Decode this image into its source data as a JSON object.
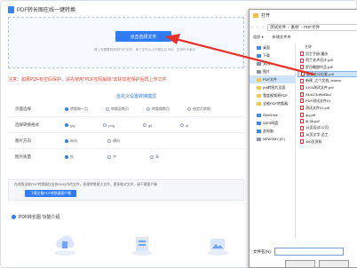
{
  "header": {
    "title": "PDF转长图在线一键转换"
  },
  "upload": {
    "button_label": "点击选择文件",
    "hint": "请上传需要转换的PDF文件，单个文件大小不超过(2.0M)，支持PDF格式"
  },
  "notice": "注意：如果PDF有密码保护，请先使用\"PDF密码解除\"去除加密保护后再上传文件",
  "settings": {
    "title": "自定义设置转换模式",
    "rows": [
      {
        "label": "页面选择",
        "options": [
          "转换每一页",
          "转换奇数页",
          "转换偶数页",
          "指定页转换"
        ],
        "selected": 0
      },
      {
        "label": "选择转换格式",
        "options": [
          "jpg",
          "png",
          "gif",
          "tif"
        ],
        "selected": 0
      },
      {
        "label": "图片方向",
        "options": [
          "纵向",
          "横向"
        ],
        "selected": 0
      },
      {
        "label": "图片质量",
        "options": [
          "低",
          "中",
          "高"
        ],
        "selected": 0
      }
    ]
  },
  "bottom_note": {
    "text": "在线版全能PDF转换器仅支持2M以内的文件，如需转换更大文件，更多格式文件，请下载客户端",
    "button_label": "下载全能PDF转换器客户端"
  },
  "features_title": "PDF转长图 功能介绍",
  "dialog": {
    "title": "打开",
    "path": [
      "测试文件",
      "素材",
      "PDF文件"
    ],
    "toolbar": [
      "组织 ▾",
      "新建文件夹"
    ],
    "nav_items": [
      {
        "label": "桌面",
        "color": "blue",
        "selected": false
      },
      {
        "label": "下载",
        "color": "blue",
        "selected": false
      },
      {
        "label": "文档",
        "color": "gray",
        "selected": false
      },
      {
        "label": "图片",
        "color": "gray",
        "selected": false
      },
      {
        "label": "PDF文件",
        "color": "yellow",
        "selected": true
      },
      {
        "label": "pdf转图片页面",
        "color": "yellow",
        "selected": false
      },
      {
        "label": "零度视频原PDF",
        "color": "yellow",
        "selected": false
      },
      {
        "label": "全能PDF转换器",
        "color": "yellow",
        "selected": false
      },
      {
        "label": "OneDrive",
        "color": "blue",
        "selected": false
      },
      {
        "label": "WPS网盘",
        "color": "blue",
        "selected": false
      },
      {
        "label": "此电脑",
        "color": "blue",
        "selected": false
      },
      {
        "label": "NEWSMY (E:)",
        "color": "gray",
        "selected": false
      }
    ],
    "column_header": "名称",
    "files": [
      {
        "name": "员工手册-重庆",
        "selected": false
      },
      {
        "name": "荷兰艺术设计.pdf",
        "selected": false
      },
      {
        "name": "罗丹雕塑作品.pdf",
        "selected": false
      },
      {
        "name": "圆桌会议纪要.pdf",
        "selected": true
      },
      {
        "name": "新建_之个文档_teamw",
        "selected": false
      },
      {
        "name": "0104测试文件.pdf",
        "selected": false
      },
      {
        "name": "54d473dffcd5bd",
        "selected": false
      },
      {
        "name": "PDF测试文件01",
        "selected": false
      },
      {
        "name": "测试文件01.pdf",
        "selected": false
      },
      {
        "name": "qq.pdf",
        "selected": false
      },
      {
        "name": "8f 38.pdf",
        "selected": false
      },
      {
        "name": "16页培训-公司",
        "selected": false
      },
      {
        "name": "16页文字-员工",
        "selected": false
      },
      {
        "name": "480页资料",
        "selected": false
      }
    ],
    "filename_label": "文件名(N):"
  },
  "colors": {
    "accent": "#2f7cf6",
    "warning": "#e24b3b",
    "arrow": "#e8302a"
  }
}
